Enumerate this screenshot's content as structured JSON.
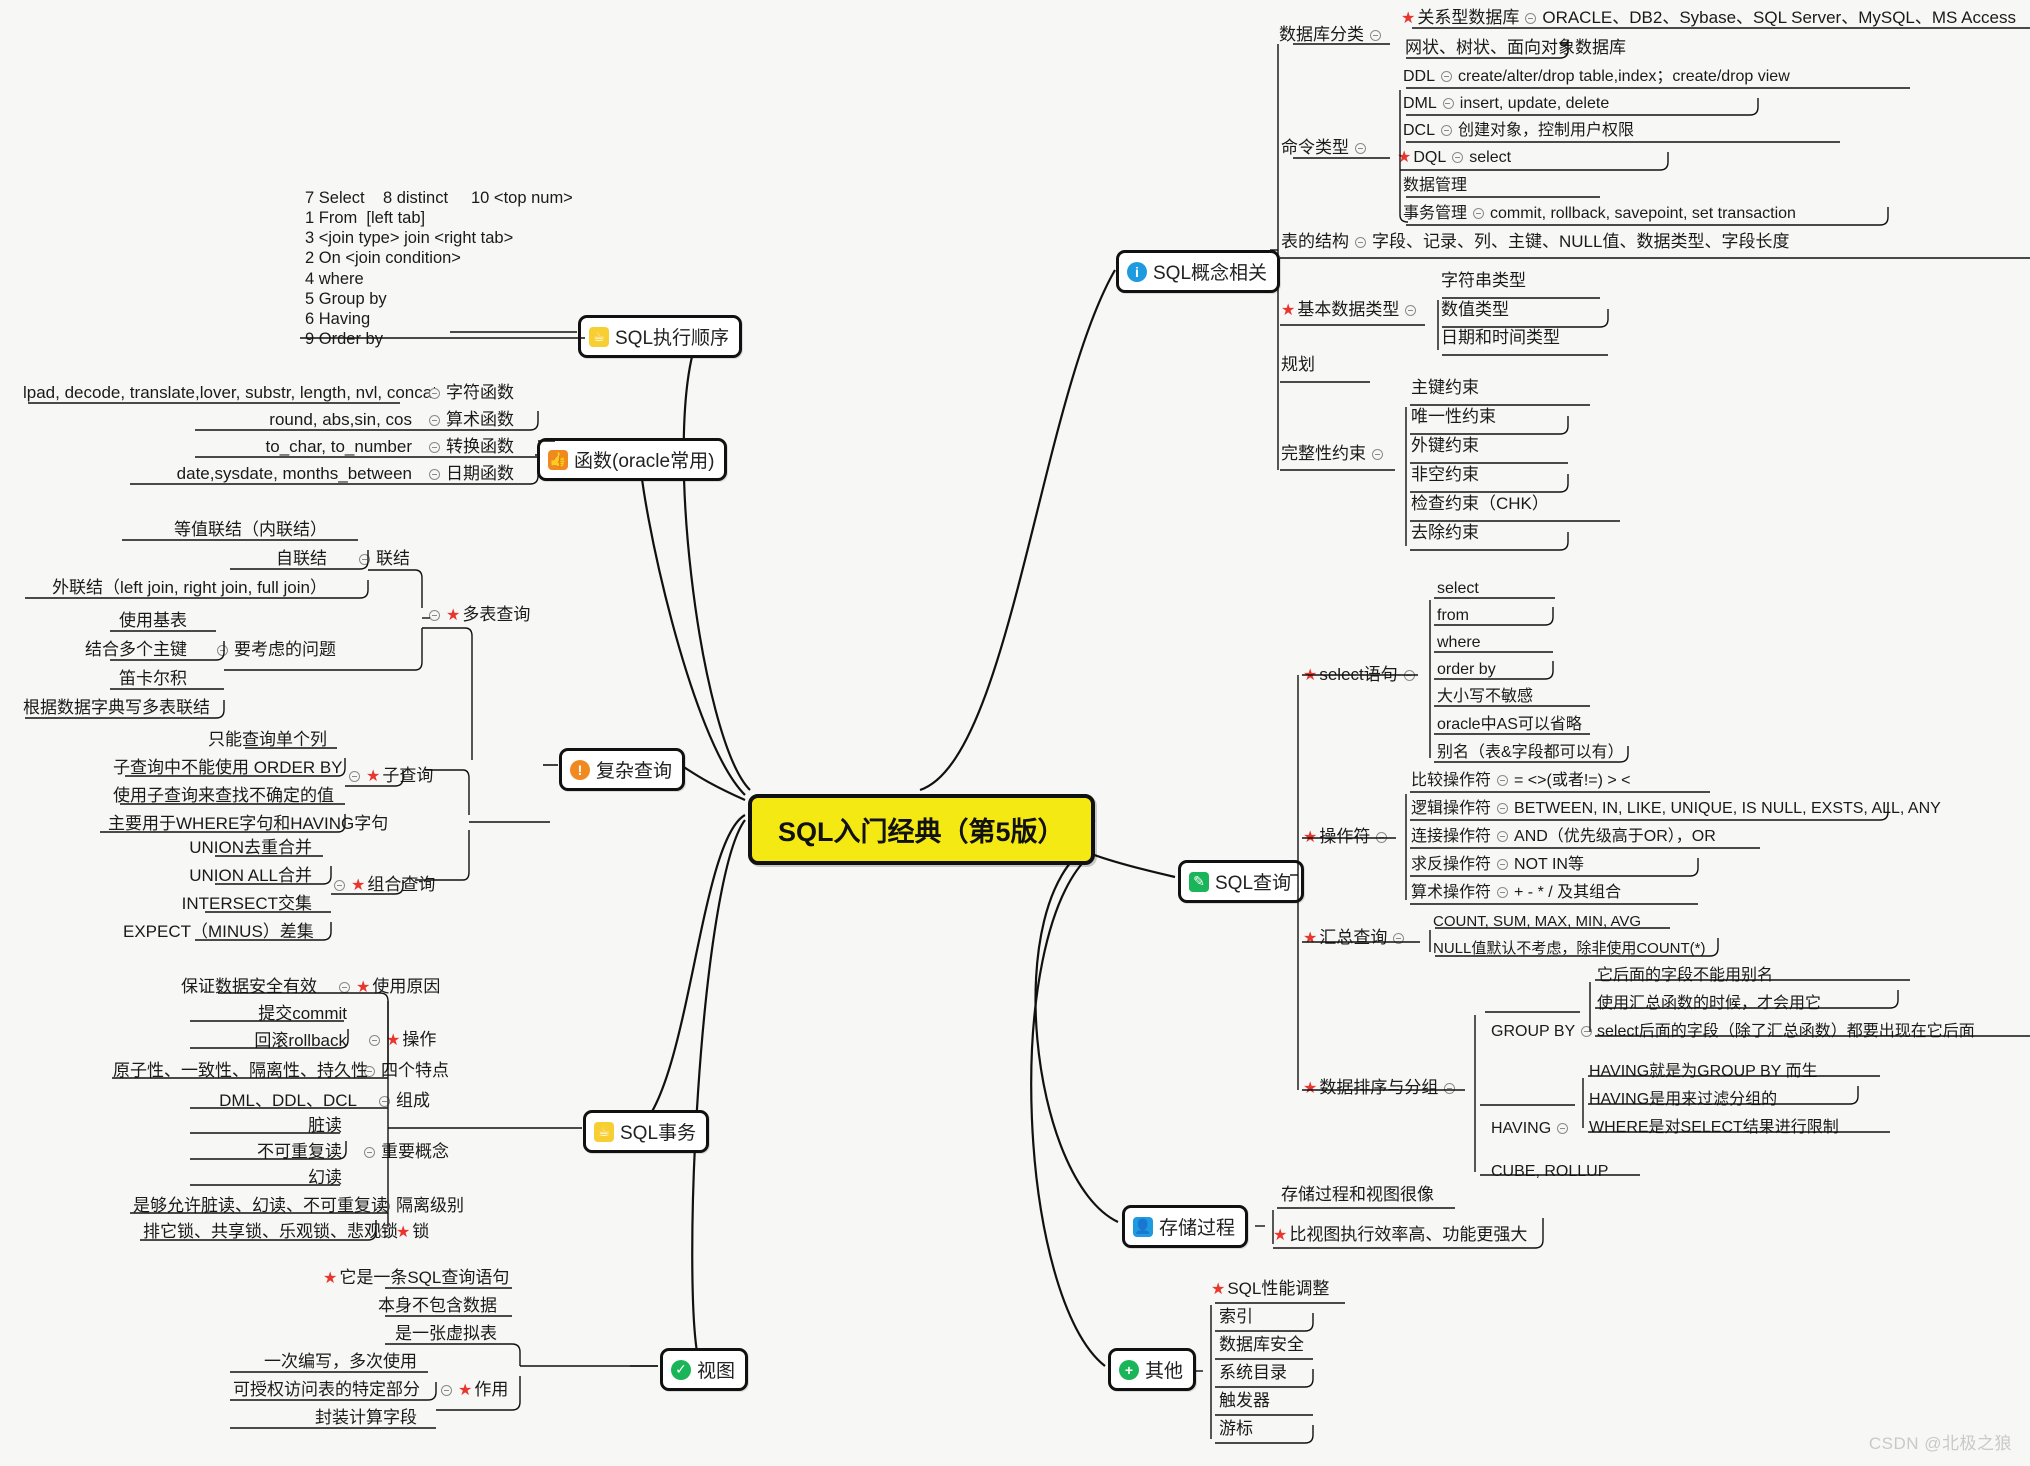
{
  "center": {
    "title": "SQL入门经典（第5版）",
    "color": "#f5e914"
  },
  "watermark": "CSDN @北极之狼",
  "branches": {
    "exec_order": {
      "label": "SQL执行顺序",
      "icon": "trophy-icon"
    },
    "functions": {
      "label": "函数(oracle常用)",
      "icon": "thumbs-up-icon"
    },
    "complex": {
      "label": "复杂查询",
      "icon": "warning-icon"
    },
    "transaction": {
      "label": "SQL事务",
      "icon": "trophy-icon"
    },
    "view": {
      "label": "视图",
      "icon": "check-circle-icon"
    },
    "concepts": {
      "label": "SQL概念相关",
      "icon": "info-icon"
    },
    "query": {
      "label": "SQL查询",
      "icon": "pencil-icon"
    },
    "procedure": {
      "label": "存储过程",
      "icon": "person-icon"
    },
    "other": {
      "label": "其他",
      "icon": "plus-circle-icon"
    }
  },
  "exec_order_lines": "7 Select    8 distinct     10 <top num>\n1 From  [left tab]\n3 <join type> join <right tab>\n2 On <join condition>\n4 where\n5 Group by\n6 Having\n9 Order by",
  "functions_rows": [
    {
      "detail": "lpad, decode, translate,lover, substr, length, nvl, concat",
      "label": "字符函数"
    },
    {
      "detail": "round, abs,sin, cos",
      "label": "算术函数"
    },
    {
      "detail": "to_char, to_number",
      "label": "转换函数"
    },
    {
      "detail": "date,sysdate, months_between",
      "label": "日期函数"
    }
  ],
  "multi_table": {
    "label": "多表查询",
    "star": true,
    "groups": [
      {
        "label": "联结",
        "items": [
          "等值联结（内联结）",
          "自联结",
          "外联结（left join, right join, full join）"
        ]
      },
      {
        "label": "要考虑的问题",
        "items": [
          "使用基表",
          "结合多个主键",
          "笛卡尔积",
          "根据数据字典写多表联结"
        ]
      }
    ]
  },
  "subquery": {
    "label": "子查询",
    "star": true,
    "items": [
      "只能查询单个列",
      "子查询中不能使用 ORDER BY",
      "使用子查询来查找不确定的值",
      "主要用于WHERE字句和HAVING字句"
    ]
  },
  "union_query": {
    "label": "组合查询",
    "star": true,
    "items": [
      "UNION去重合并",
      "UNION ALL合并",
      "INTERSECT交集",
      "EXPECT（MINUS）差集"
    ]
  },
  "transaction_groups": [
    {
      "label": "使用原因",
      "star": true,
      "items": [
        "保证数据安全有效"
      ]
    },
    {
      "label": "操作",
      "star": true,
      "items": [
        "提交commit",
        "回滚rollback"
      ]
    },
    {
      "label": "四个特点",
      "star": false,
      "items": [
        "原子性、一致性、隔离性、持久性"
      ]
    },
    {
      "label": "组成",
      "star": false,
      "items": [
        "DML、DDL、DCL"
      ]
    },
    {
      "label": "重要概念",
      "star": false,
      "items": [
        "脏读",
        "不可重复读",
        "幻读"
      ]
    },
    {
      "label": "隔离级别",
      "star": false,
      "items": [
        "是够允许脏读、幻读、不可重复读"
      ]
    },
    {
      "label": "锁",
      "star": true,
      "items": [
        "排它锁、共享锁、乐观锁、悲观锁"
      ]
    }
  ],
  "view_items": [
    "它是一条SQL查询语句",
    "本身不包含数据",
    "是一张虚拟表"
  ],
  "view_effect": {
    "label": "作用",
    "star": true,
    "items": [
      "一次编写，多次使用",
      "可授权访问表的特定部分",
      "封装计算字段"
    ]
  },
  "concepts": {
    "db_classify": {
      "label": "数据库分类",
      "rows": [
        {
          "label": "关系型数据库",
          "star": true,
          "detail": "ORACLE、DB2、Sybase、SQL Server、MySQL、MS Access"
        },
        {
          "label": "网状、树状、面向对象数据库",
          "star": false,
          "detail": ""
        }
      ]
    },
    "cmd_type": {
      "label": "命令类型",
      "rows": [
        {
          "label": "DDL",
          "star": false,
          "detail": "create/alter/drop table,index；create/drop view"
        },
        {
          "label": "DML",
          "star": false,
          "detail": "insert, update, delete"
        },
        {
          "label": "DCL",
          "star": false,
          "detail": "创建对象，控制用户权限"
        },
        {
          "label": "DQL",
          "star": true,
          "detail": "select"
        },
        {
          "label": "数据管理",
          "star": false,
          "detail": ""
        },
        {
          "label": "事务管理",
          "star": false,
          "detail": "commit, rollback, savepoint, set transaction"
        }
      ]
    },
    "table_struct": {
      "label": "表的结构",
      "detail": "字段、记录、列、主键、NULL值、数据类型、字段长度"
    },
    "data_types": {
      "label": "基本数据类型",
      "star": true,
      "items": [
        "字符串类型",
        "数值类型",
        "日期和时间类型"
      ]
    },
    "plan": {
      "label": "规划"
    },
    "constraints": {
      "label": "完整性约束",
      "items": [
        "主键约束",
        "唯一性约束",
        "外键约束",
        "非空约束",
        "检查约束（CHK）",
        "去除约束"
      ]
    }
  },
  "query": {
    "select_stmt": {
      "label": "select语句",
      "star": true,
      "items": [
        "select",
        "from",
        "where",
        "order by",
        "大小写不敏感",
        "oracle中AS可以省略",
        "别名（表&字段都可以有）"
      ]
    },
    "operators": {
      "label": "操作符",
      "star": true,
      "rows": [
        {
          "label": "比较操作符",
          "detail": "=  <>(或者!=) >  <"
        },
        {
          "label": "逻辑操作符",
          "detail": "BETWEEN, IN, LIKE, UNIQUE, IS NULL, EXSTS, ALL, ANY"
        },
        {
          "label": "连接操作符",
          "detail": "AND（优先级高于OR），OR"
        },
        {
          "label": "求反操作符",
          "detail": "NOT IN等"
        },
        {
          "label": "算术操作符",
          "detail": "+ - * / 及其组合"
        }
      ]
    },
    "aggregate": {
      "label": "汇总查询",
      "star": true,
      "items": [
        "COUNT, SUM, MAX, MIN, AVG",
        "NULL值默认不考虑，除非使用COUNT(*)"
      ]
    },
    "sort_group": {
      "label": "数据排序与分组",
      "star": true,
      "groups": [
        {
          "label": "GROUP BY",
          "items": [
            "它后面的字段不能用别名",
            "使用汇总函数的时候，才会用它",
            "select后面的字段（除了汇总函数）都要出现在它后面"
          ]
        },
        {
          "label": "HAVING",
          "items": [
            "HAVING就是为GROUP BY 而生",
            "HAVING是用来过滤分组的",
            "WHERE是对SELECT结果进行限制"
          ]
        },
        {
          "label": "CUBE, ROLLUP",
          "items": []
        }
      ]
    }
  },
  "procedure_items": [
    {
      "text": "存储过程和视图很像",
      "star": false
    },
    {
      "text": "比视图执行效率高、功能更强大",
      "star": true
    }
  ],
  "other_items": [
    {
      "text": "SQL性能调整",
      "star": true
    },
    {
      "text": "索引",
      "star": false
    },
    {
      "text": "数据库安全",
      "star": false
    },
    {
      "text": "系统目录",
      "star": false
    },
    {
      "text": "触发器",
      "star": false
    },
    {
      "text": "游标",
      "star": false
    }
  ]
}
